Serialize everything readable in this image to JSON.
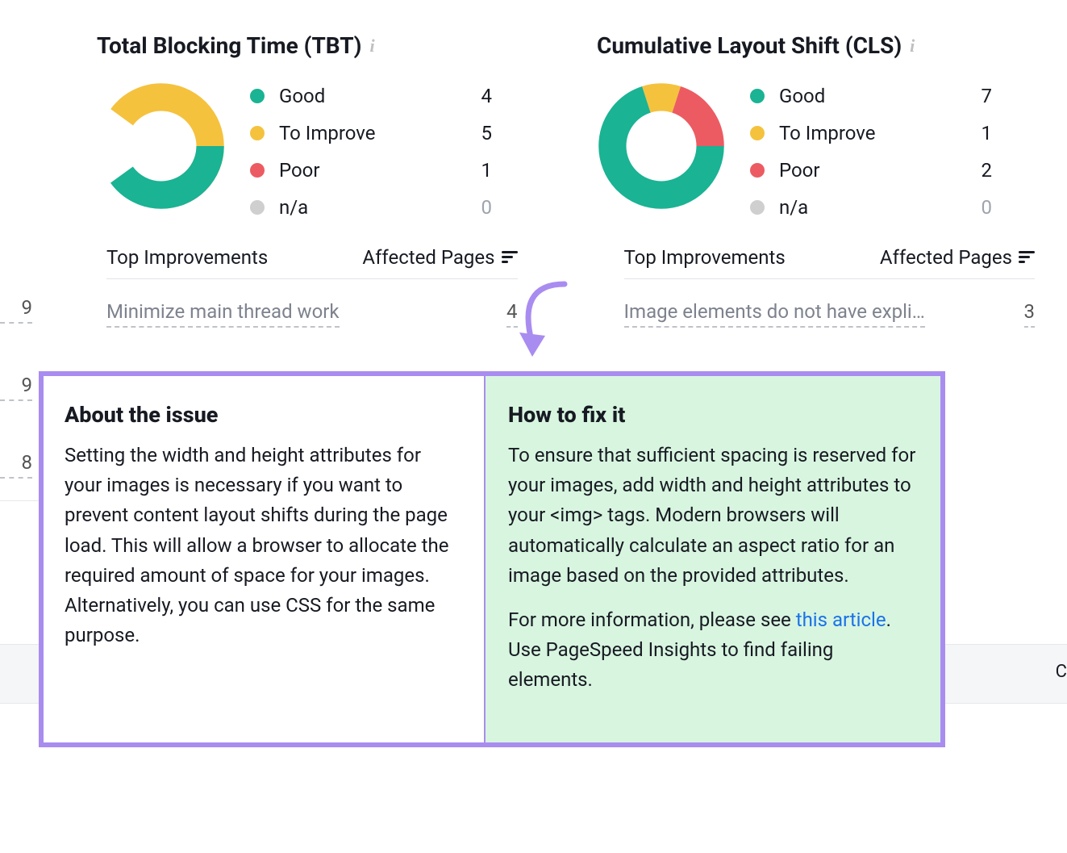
{
  "metrics": [
    {
      "title": "Total Blocking Time (TBT)",
      "legend": [
        {
          "label": "Good",
          "value": "4",
          "zero": false
        },
        {
          "label": "To Improve",
          "value": "5",
          "zero": false
        },
        {
          "label": "Poor",
          "value": "1",
          "zero": false
        },
        {
          "label": "n/a",
          "value": "0",
          "zero": true
        }
      ],
      "chart_data": {
        "type": "pie",
        "categories": [
          "Good",
          "To Improve",
          "Poor",
          "n/a"
        ],
        "values": [
          4,
          5,
          1,
          0
        ],
        "colors": [
          "#1ab394",
          "#f5c23e",
          "#ec5b62",
          "#cfcfcf"
        ]
      }
    },
    {
      "title": "Cumulative Layout Shift (CLS)",
      "legend": [
        {
          "label": "Good",
          "value": "7",
          "zero": false
        },
        {
          "label": "To Improve",
          "value": "1",
          "zero": false
        },
        {
          "label": "Poor",
          "value": "2",
          "zero": false
        },
        {
          "label": "n/a",
          "value": "0",
          "zero": true
        }
      ],
      "chart_data": {
        "type": "pie",
        "categories": [
          "Good",
          "To Improve",
          "Poor",
          "n/a"
        ],
        "values": [
          7,
          1,
          2,
          0
        ],
        "colors": [
          "#1ab394",
          "#f5c23e",
          "#ec5b62",
          "#cfcfcf"
        ]
      }
    }
  ],
  "side_numbers": [
    "9",
    "9",
    "8"
  ],
  "improvements": {
    "header_top": "Top Improvements",
    "header_affected": "Affected Pages",
    "left": {
      "label": "Minimize main thread work",
      "count": "4"
    },
    "right": {
      "label": "Image elements do not have expli…",
      "count": "3"
    }
  },
  "callout": {
    "about_title": "About the issue",
    "about_body": "Setting the width and height attributes for your images is necessary if you want to prevent content layout shifts during the page load. This will allow a browser to allocate the required amount of space for your images. Alternatively, you can use CSS for the same purpose.",
    "fix_title": "How to fix it",
    "fix_body1": "To ensure that sufficient spacing is reserved for your images, add width and height attributes to your <img> tags. Modern browsers will automatically calculate an aspect ratio for an image based on the provided attributes.",
    "fix_body2_pre": "For more information, please see ",
    "fix_link": "this article",
    "fix_body2_post": ". Use PageSpeed Insights to find failing elements."
  },
  "colors": {
    "good": "#1ab394",
    "improve": "#f5c23e",
    "poor": "#ec5b62",
    "na": "#cfcfcf"
  }
}
